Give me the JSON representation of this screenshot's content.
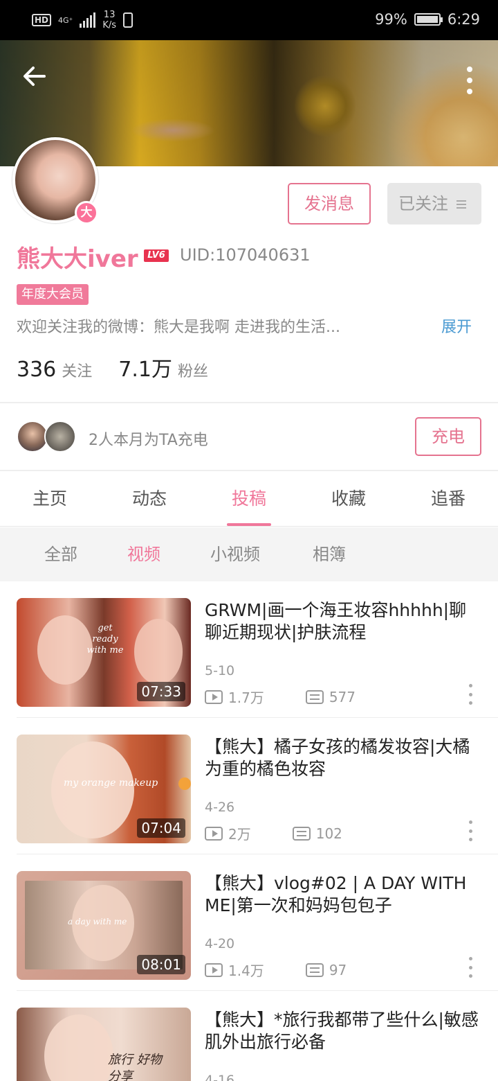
{
  "status_bar": {
    "network": "HD",
    "signal_label": "4G⁺",
    "speed": "13",
    "speed_unit": "K/s",
    "battery_level": 0.99,
    "battery": "99%",
    "time": "6:29"
  },
  "header": {
    "back_icon": "back-arrow-icon",
    "more_icon": "more-vertical-icon"
  },
  "profile": {
    "avatar_badge": "大",
    "message_button": "发消息",
    "follow_button": "已关注",
    "username": "熊大大iver",
    "level": "LV6",
    "uid": "UID:107040631",
    "vip_tag": "年度大会员",
    "bio": "欢迎关注我的微博：熊大是我啊  走进我的生活...",
    "expand": "展开",
    "following_count": "336",
    "following_label": "关注",
    "fans_count": "7.1万",
    "fans_label": "粉丝"
  },
  "charge": {
    "text": "2人本月为TA充电",
    "button": "充电"
  },
  "tabs": [
    {
      "label": "主页"
    },
    {
      "label": "动态"
    },
    {
      "label": "投稿"
    },
    {
      "label": "收藏"
    },
    {
      "label": "追番"
    }
  ],
  "active_tab": "投稿",
  "subtabs": [
    {
      "label": "全部"
    },
    {
      "label": "视频"
    },
    {
      "label": "小视频"
    },
    {
      "label": "相簿"
    }
  ],
  "active_subtab": "视频",
  "videos": [
    {
      "title": "GRWM|画一个海王妆容hhhhh|聊聊近期现状|护肤流程",
      "date": "5-10",
      "views": "1.7万",
      "danmaku": "577",
      "duration": "07:33",
      "thumb_text": "get ready with me"
    },
    {
      "title": "【熊大】橘子女孩的橘发妆容|大橘为重的橘色妆容",
      "date": "4-26",
      "views": "2万",
      "danmaku": "102",
      "duration": "07:04",
      "thumb_text": "my orange makeup"
    },
    {
      "title": "【熊大】vlog#02 | A DAY WITH ME|第一次和妈妈包包子",
      "date": "4-20",
      "views": "1.4万",
      "danmaku": "97",
      "duration": "08:01",
      "thumb_text": "a day with me"
    },
    {
      "title": "【熊大】*旅行我都带了些什么|敏感肌外出旅行必备",
      "date": "4-16",
      "thumb_text": "旅行 好物分享"
    }
  ]
}
